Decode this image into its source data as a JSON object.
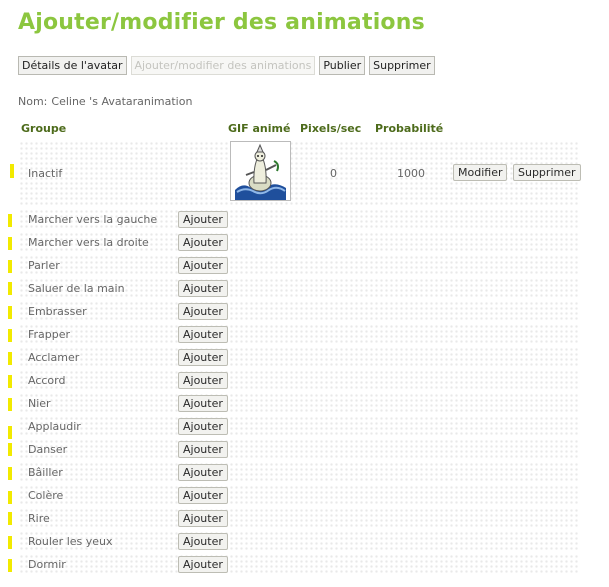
{
  "page": {
    "title": "Ajouter/modifier des animations"
  },
  "tabs": [
    {
      "label": "Détails de l'avatar",
      "disabled": false
    },
    {
      "label": "Ajouter/modifier des animations",
      "disabled": true
    },
    {
      "label": "Publier",
      "disabled": false
    },
    {
      "label": "Supprimer",
      "disabled": false
    }
  ],
  "avatar": {
    "name_label": "Nom:",
    "name_value": "Celine 's Avataranimation"
  },
  "table": {
    "headers": {
      "group": "Groupe",
      "gif": "GIF animé",
      "pixels": "Pixels/sec",
      "probability": "Probabilité"
    },
    "first_row": {
      "label": "Inactif",
      "gif_icon": "animated-figure-gif",
      "pixels_per_sec": "0",
      "probability": "1000",
      "modify_label": "Modifier",
      "delete_label": "Supprimer"
    },
    "rows": [
      {
        "label": "Marcher vers la gauche",
        "button": "Ajouter"
      },
      {
        "label": "Marcher vers la droite",
        "button": "Ajouter"
      },
      {
        "label": "Parler",
        "button": "Ajouter"
      },
      {
        "label": "Saluer de la main",
        "button": "Ajouter"
      },
      {
        "label": "Embrasser",
        "button": "Ajouter"
      },
      {
        "label": "Frapper",
        "button": "Ajouter"
      },
      {
        "label": "Acclamer",
        "button": "Ajouter"
      },
      {
        "label": "Accord",
        "button": "Ajouter"
      },
      {
        "label": "Nier",
        "button": "Ajouter"
      },
      {
        "label": "Applaudir",
        "button": "Ajouter"
      },
      {
        "label": "Danser",
        "button": "Ajouter"
      },
      {
        "label": "Bâiller",
        "button": "Ajouter"
      },
      {
        "label": "Colère",
        "button": "Ajouter"
      },
      {
        "label": "Rire",
        "button": "Ajouter"
      },
      {
        "label": "Rouler les yeux",
        "button": "Ajouter"
      },
      {
        "label": "Dormir",
        "button": "Ajouter"
      }
    ]
  },
  "colors": {
    "title": "#8cc63f",
    "header": "#4d6b1b",
    "highlight_marks": "#f2ea00"
  }
}
